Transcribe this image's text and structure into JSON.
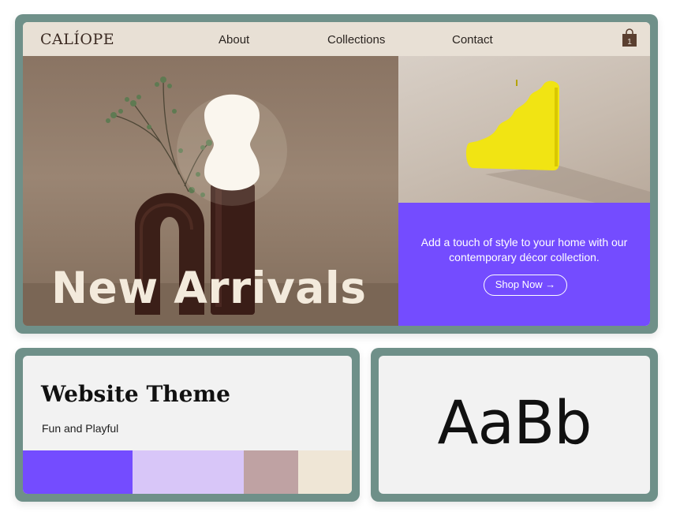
{
  "nav": {
    "logo": "CALÍOPE",
    "links": [
      "About",
      "Collections",
      "Contact"
    ],
    "cart_icon": "shopping-bag-icon",
    "cart_count": "1"
  },
  "hero": {
    "title": "New Arrivals",
    "promo_text": "Add a touch of style to your home with our contemporary décor collection.",
    "cta_label": "Shop Now →"
  },
  "theme": {
    "title": "Website Theme",
    "subtitle": "Fun and Playful",
    "palette": [
      "#744cff",
      "#d8c6f8",
      "#bfa2a3",
      "#efe6d6"
    ]
  },
  "typography": {
    "sample": "AaBb"
  },
  "colors": {
    "frame": "#6f9089",
    "accent": "#744cff",
    "nav_bg": "#e8e0d5"
  }
}
